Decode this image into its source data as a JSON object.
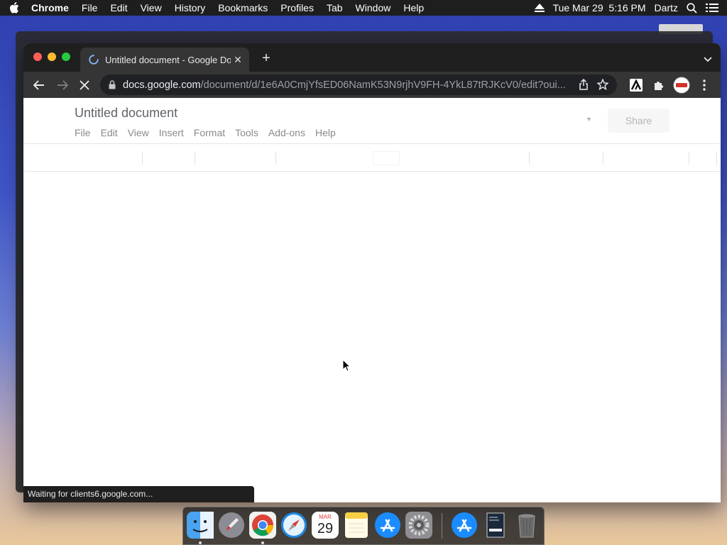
{
  "menubar": {
    "app_name": "Chrome",
    "items": [
      "File",
      "Edit",
      "View",
      "History",
      "Bookmarks",
      "Profiles",
      "Tab",
      "Window",
      "Help"
    ],
    "datetime": "Tue Mar 29  5:16 PM",
    "user": "Dartz"
  },
  "browser": {
    "tab_title": "Untitled document - Google Do",
    "url_domain": "docs.google.com",
    "url_path": "/document/d/1e6A0CmjYfsED06NamK53N9rjhV9FH-4YkL87tRJKcV0/edit?oui...",
    "status_text": "Waiting for clients6.google.com..."
  },
  "docs": {
    "title": "Untitled document",
    "menu": [
      "File",
      "Edit",
      "View",
      "Insert",
      "Format",
      "Tools",
      "Add-ons",
      "Help"
    ],
    "share_label": "Share"
  },
  "dock": {
    "calendar_month": "MAR",
    "calendar_day": "29"
  },
  "colors": {
    "menubar_bg": "#1e1e1e",
    "tabstrip_bg": "#1f1f1f",
    "toolbar_bg": "#353535",
    "omnibox_bg": "#202124"
  }
}
